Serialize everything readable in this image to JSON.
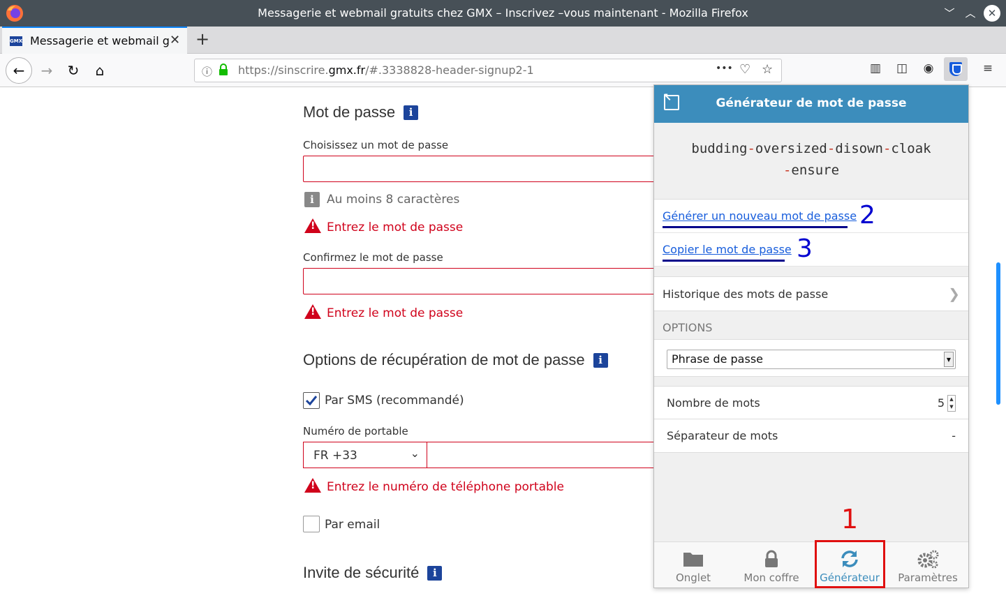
{
  "window": {
    "title": "Messagerie et webmail gratuits chez GMX – Inscrivez –vous maintenant - Mozilla Firefox"
  },
  "tab": {
    "favicon": "GMX",
    "label": "Messagerie et webmail gratuits chez GMX",
    "close": "✕",
    "new_tab": "+"
  },
  "navbar": {
    "url_prefix": "https://sinscrire.",
    "url_domain": "gmx.fr",
    "url_suffix": "/#.3338828-header-signup2-1",
    "more": "•••"
  },
  "form": {
    "password_title": "Mot de passe",
    "info_badge": "i",
    "choose_label": "Choisissez un mot de passe",
    "hint_min": "Au moins 8 caractères",
    "err_enter_pw": "Entrez le mot de passe",
    "confirm_label": "Confirmez le mot de passe",
    "err_confirm_pw": "Entrez le mot de passe",
    "recovery_title": "Options de récupération de mot de passe",
    "sms_label": "Par SMS (recommandé)",
    "mobile_label": "Numéro de portable",
    "country_code": "FR +33",
    "err_phone": "Entrez le numéro de téléphone portable",
    "email_label": "Par email",
    "security_title": "Invite de sécurité"
  },
  "bitwarden": {
    "header_title": "Générateur de mot de passe",
    "password_words": [
      "budding",
      "oversized",
      "disown",
      "cloak",
      "ensure"
    ],
    "password_separator": "-",
    "generate_link": "Générer un nouveau mot de passe",
    "copy_link": "Copier le mot de passe",
    "history_label": "Historique des mots de passe",
    "options_header": "OPTIONS",
    "type_value": "Phrase de passe",
    "num_words_label": "Nombre de mots",
    "num_words_value": "5",
    "word_sep_label": "Séparateur de mots",
    "word_sep_value": "-",
    "tabs": [
      {
        "label": "Onglet",
        "icon": "folder-icon"
      },
      {
        "label": "Mon coffre",
        "icon": "lock-icon"
      },
      {
        "label": "Générateur",
        "icon": "refresh-icon"
      },
      {
        "label": "Paramètres",
        "icon": "gears-icon"
      }
    ]
  },
  "annotations": {
    "one": "1",
    "two": "2",
    "three": "3"
  }
}
